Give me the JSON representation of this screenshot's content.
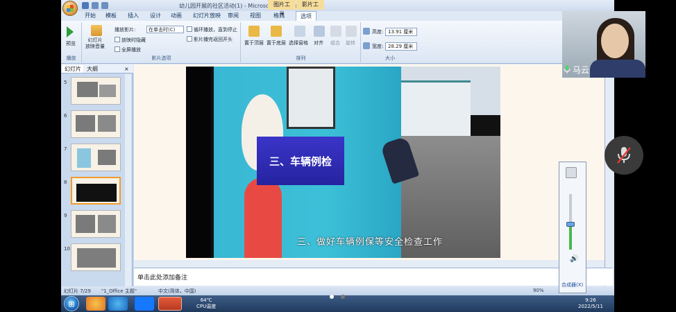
{
  "window": {
    "title": "幼儿园开展的社区活动(1) - Microsoft PowerPoint",
    "context_tabs": [
      "图片工具",
      "影片工具"
    ],
    "tabs": [
      "开始",
      "模板",
      "插入",
      "设计",
      "动画",
      "幻灯片放映",
      "审阅",
      "视图",
      "格式",
      "选项"
    ],
    "active_tab": "选项"
  },
  "ribbon": {
    "preview_label": "预览",
    "preview_group": "播放",
    "slide_volume_label": "幻灯片\n放映音量",
    "play_movie_label": "播放影片:",
    "play_movie_value": "在单击时(C)",
    "hide_when_not_playing": "放映时隐藏",
    "full_screen": "全屏播放",
    "loop_until_stopped": "循环播放，直到停止",
    "rewind_after": "影片播完返回开头",
    "movie_options_group": "影片选项",
    "bring_front": "置于顶层",
    "send_back": "置于底层",
    "selection_pane": "选择窗格",
    "align": "对齐",
    "group": "组合",
    "rotate": "旋转",
    "arrange_group": "排列",
    "height_label": "高度:",
    "height_value": "13.91 厘米",
    "width_label": "宽度:",
    "width_value": "28.29 厘米",
    "size_group": "大小"
  },
  "pane": {
    "tab_slides": "幻灯片",
    "tab_outline": "大纲",
    "close": "×",
    "thumb_numbers": [
      "5",
      "6",
      "7",
      "8",
      "9",
      "10"
    ]
  },
  "slide": {
    "banner_text": "三、车辆例检",
    "caption_text": "三、做好车辆例保等安全检查工作"
  },
  "notes": {
    "placeholder": "单击此处添加备注"
  },
  "status": {
    "slide_pos": "幻灯片 7/29",
    "theme": "\"1_Office 主题\"",
    "language": "中文(简体，中国)",
    "zoom": "90%"
  },
  "volume_popup": {
    "mixer_label": "合成器(X)",
    "level": 0.42
  },
  "taskbar": {
    "cpu_temp": "64℃",
    "cpu_label": "CPU温度",
    "time": "9:26",
    "date": "2022/5/11"
  },
  "video_call": {
    "participant_name": "马云"
  },
  "colors": {
    "banner": "#2f2cb8",
    "ribbon_bg": "#dbe6f4",
    "selected_thumb_border": "#f29b2b"
  }
}
